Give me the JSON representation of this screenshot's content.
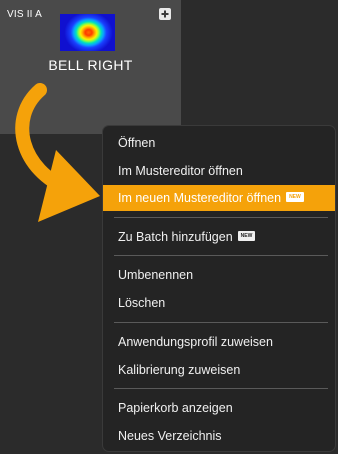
{
  "tile": {
    "tag": "VIS II A",
    "title": "BELL RIGHT",
    "badge_icon": "plus-icon",
    "thumbnail": "heatmap-thumbnail"
  },
  "arrow": {
    "color": "#f5a20a",
    "icon": "curved-arrow"
  },
  "menu": {
    "highlight_color": "#f5a20a",
    "new_badge": "NEW",
    "items": [
      {
        "label": "Öffnen"
      },
      {
        "label": "Im Mustereditor öffnen"
      },
      {
        "label": "Im neuen Mustereditor öffnen",
        "highlighted": true,
        "badge": true
      },
      {
        "label": "Zu Batch hinzufügen",
        "badge": true
      },
      {
        "label": "Umbenennen"
      },
      {
        "label": "Löschen"
      },
      {
        "label": "Anwendungsprofil zuweisen"
      },
      {
        "label": "Kalibrierung zuweisen"
      },
      {
        "label": "Papierkorb anzeigen"
      },
      {
        "label": "Neues Verzeichnis"
      }
    ]
  }
}
